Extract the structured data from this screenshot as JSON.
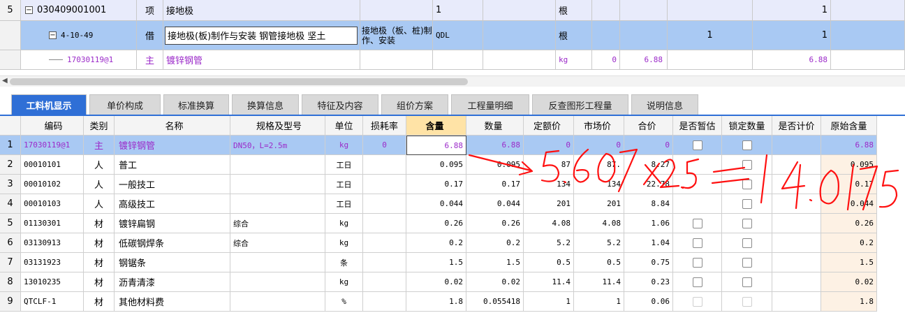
{
  "top_table": {
    "rows": [
      {
        "num": "5",
        "code": "030409001001",
        "type": "项",
        "name": "接地极",
        "feature": "",
        "unit_qty": "1",
        "mark": "",
        "unit": "根",
        "e1": "",
        "e2": "",
        "e3": "",
        "e4": "1"
      },
      {
        "num": "",
        "code": "4-10-49",
        "type": "借",
        "name": "接地极(板)制作与安装 钢管接地极 坚土",
        "feature": "接地极（板、桩)制作、安装",
        "unit_qty": "QDL",
        "mark": "",
        "unit": "根",
        "e1": "",
        "e2": "",
        "e3": "1",
        "e4": "1"
      },
      {
        "num": "",
        "code": "17030119@1",
        "type": "主",
        "name": "镀锌钢管",
        "feature": "",
        "unit_qty": "",
        "mark": "",
        "unit": "kg",
        "e1": "0",
        "e2": "6.88",
        "e3": "",
        "e4": "6.88"
      }
    ]
  },
  "tabs": [
    "工料机显示",
    "单价构成",
    "标准换算",
    "换算信息",
    "特征及内容",
    "组价方案",
    "工程量明细",
    "反查图形工程量",
    "说明信息"
  ],
  "grid": {
    "headers": {
      "code": "编码",
      "cat": "类别",
      "name": "名称",
      "spec": "规格及型号",
      "unit": "单位",
      "loss": "损耗率",
      "qty": "含量",
      "amt": "数量",
      "quota": "定额价",
      "mkt": "市场价",
      "total": "合价",
      "est": "是否暂估",
      "lock": "锁定数量",
      "price": "是否计价",
      "orig": "原始含量"
    },
    "rows": [
      {
        "idx": "1",
        "code": "17030119@1",
        "cat": "主",
        "name": "镀锌钢管",
        "spec": "DN50，L=2.5m",
        "unit": "kg",
        "loss": "0",
        "qty": "6.88",
        "amt": "6.88",
        "quota": "0",
        "mkt": "0",
        "total": "0",
        "orig": "6.88"
      },
      {
        "idx": "2",
        "code": "00010101",
        "cat": "人",
        "name": "普工",
        "spec": "",
        "unit": "工日",
        "loss": "",
        "qty": "0.095",
        "amt": "0.095",
        "quota": "87",
        "mkt": "87.",
        "total": "8.27",
        "orig": "0.095"
      },
      {
        "idx": "3",
        "code": "00010102",
        "cat": "人",
        "name": "一般技工",
        "spec": "",
        "unit": "工日",
        "loss": "",
        "qty": "0.17",
        "amt": "0.17",
        "quota": "134",
        "mkt": "134",
        "total": "22.78",
        "orig": "0.17"
      },
      {
        "idx": "4",
        "code": "00010103",
        "cat": "人",
        "name": "高级技工",
        "spec": "",
        "unit": "工日",
        "loss": "",
        "qty": "0.044",
        "amt": "0.044",
        "quota": "201",
        "mkt": "201",
        "total": "8.84",
        "orig": "0.044"
      },
      {
        "idx": "5",
        "code": "01130301",
        "cat": "材",
        "name": "镀锌扁钢",
        "spec": "综合",
        "unit": "kg",
        "loss": "",
        "qty": "0.26",
        "amt": "0.26",
        "quota": "4.08",
        "mkt": "4.08",
        "total": "1.06",
        "orig": "0.26"
      },
      {
        "idx": "6",
        "code": "03130913",
        "cat": "材",
        "name": "低碳钢焊条",
        "spec": "综合",
        "unit": "kg",
        "loss": "",
        "qty": "0.2",
        "amt": "0.2",
        "quota": "5.2",
        "mkt": "5.2",
        "total": "1.04",
        "orig": "0.2"
      },
      {
        "idx": "7",
        "code": "03131923",
        "cat": "材",
        "name": "钢锯条",
        "spec": "",
        "unit": "条",
        "loss": "",
        "qty": "1.5",
        "amt": "1.5",
        "quota": "0.5",
        "mkt": "0.5",
        "total": "0.75",
        "orig": "1.5"
      },
      {
        "idx": "8",
        "code": "13010235",
        "cat": "材",
        "name": "沥青清漆",
        "spec": "",
        "unit": "kg",
        "loss": "",
        "qty": "0.02",
        "amt": "0.02",
        "quota": "11.4",
        "mkt": "11.4",
        "total": "0.23",
        "orig": "0.02"
      },
      {
        "idx": "9",
        "code": "QTCLF-1",
        "cat": "材",
        "name": "其他材料费",
        "spec": "",
        "unit": "%",
        "loss": "",
        "qty": "1.8",
        "amt": "0.055418",
        "quota": "1",
        "mkt": "1",
        "total": "0.06",
        "orig": "1.8"
      }
    ]
  },
  "annotation": {
    "color": "#ff1010",
    "text": "->5.607x2.5=14.0175"
  },
  "colors": {
    "tab_active": "#2f6fd6",
    "selected_row": "#a9c9f3",
    "main_material": "#9b2ac9",
    "qty_header": "#ffe3a6"
  }
}
